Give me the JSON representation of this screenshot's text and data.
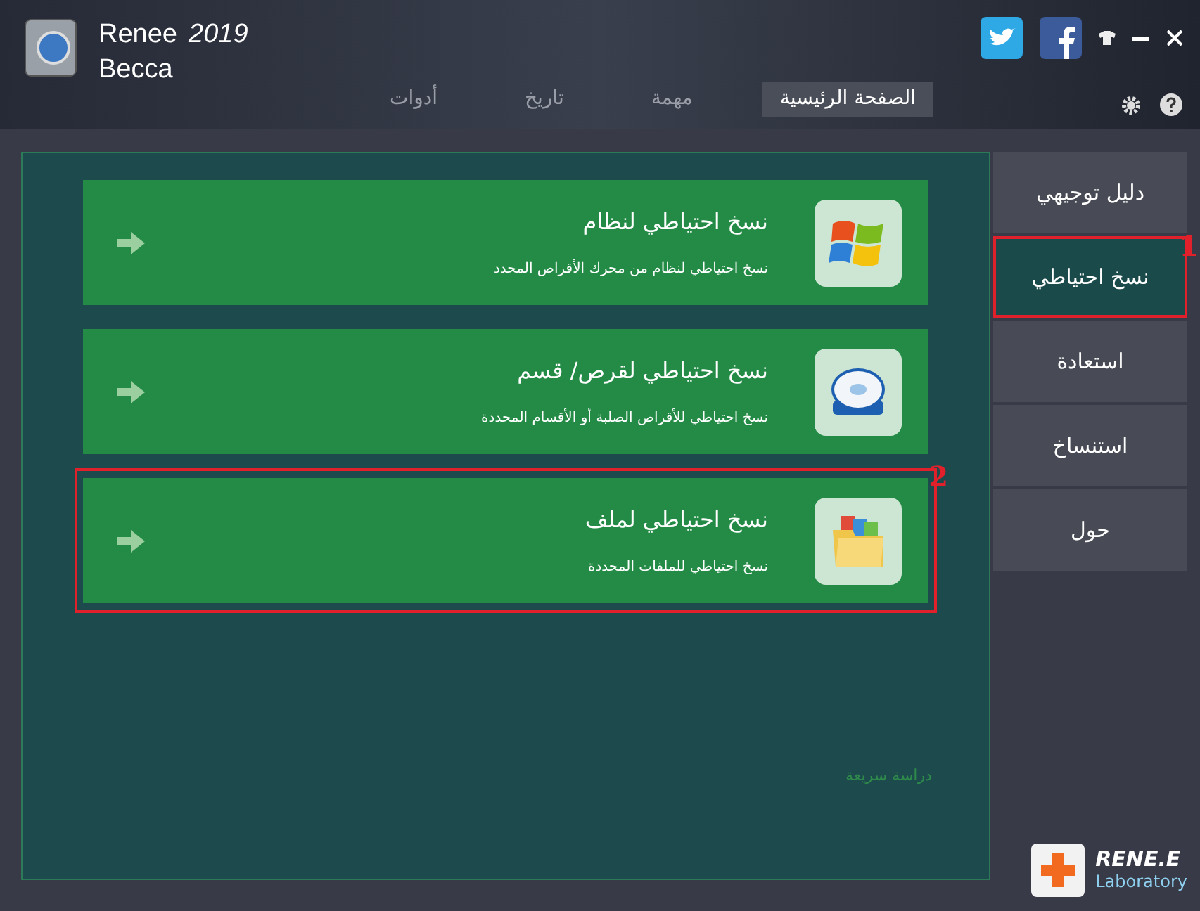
{
  "app": {
    "title": "Renee",
    "version": "2019",
    "subtitle": "Becca"
  },
  "tabs": [
    {
      "label": "الصفحة الرئيسية",
      "selected": true
    },
    {
      "label": "مهمة",
      "selected": false
    },
    {
      "label": "تاريخ",
      "selected": false
    },
    {
      "label": "أدوات",
      "selected": false
    }
  ],
  "sidebar": {
    "items": [
      {
        "label": "دليل توجيهي",
        "selected": false
      },
      {
        "label": "نسخ احتياطي",
        "selected": true,
        "annotation": "1"
      },
      {
        "label": "استعادة",
        "selected": false
      },
      {
        "label": "استنساخ",
        "selected": false
      },
      {
        "label": "حول",
        "selected": false
      }
    ]
  },
  "cards": [
    {
      "kind": "system",
      "title": "نسخ احتياطي لنظام",
      "description": "نسخ احتياطي لنظام من محرك الأقراص المحدد"
    },
    {
      "kind": "disk",
      "title": "نسخ احتياطي لقرص/ قسم",
      "description": "نسخ احتياطي للأقراص الصلبة أو الأقسام المحددة"
    },
    {
      "kind": "file",
      "title": "نسخ احتياطي لملف",
      "description": "نسخ احتياطي للملفات المحددة",
      "annotation": "2"
    }
  ],
  "quick_study_link": "دراسة سريعة",
  "logo": {
    "name": "RENE.E",
    "tagline": "Laboratory"
  }
}
